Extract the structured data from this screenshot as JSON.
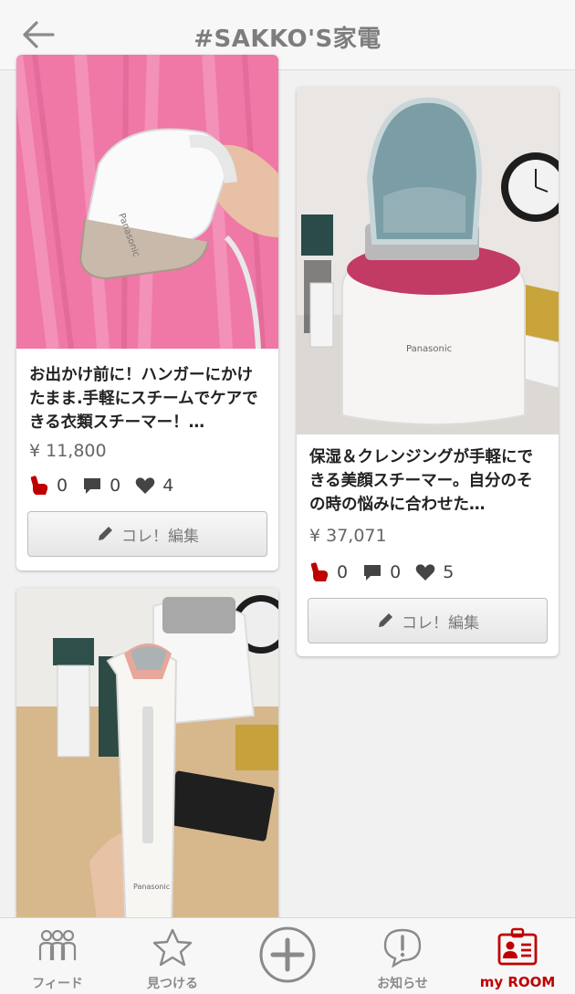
{
  "header": {
    "title": "#SAKKO'S家電"
  },
  "cards": [
    {
      "title": "お出かけ前に！ハンガーにかけたまま.手軽にスチームでケアできる衣類スチーマー！…",
      "price": "¥ 11,800",
      "coles": "0",
      "comments": "0",
      "likes": "4",
      "edit_label": "コレ！編集"
    },
    {
      "title": "保湿＆クレンジングが手軽にできる美顔スチーマー。自分のその時の悩みに合わせた…",
      "price": "¥ 37,071",
      "coles": "0",
      "comments": "0",
      "likes": "5",
      "edit_label": "コレ！編集"
    },
    {
      "title": "",
      "price": "",
      "coles": "",
      "comments": "",
      "likes": "",
      "edit_label": ""
    }
  ],
  "tabbar": {
    "items": [
      {
        "label": "フィード",
        "icon": "people-icon"
      },
      {
        "label": "見つける",
        "icon": "star-icon"
      },
      {
        "label": "",
        "icon": "plus-circle-icon"
      },
      {
        "label": "お知らせ",
        "icon": "exclamation-bubble-icon"
      },
      {
        "label": "my ROOM",
        "icon": "id-card-icon"
      }
    ]
  },
  "colors": {
    "accent": "#bf0000",
    "header_text": "#7d7d7d"
  }
}
